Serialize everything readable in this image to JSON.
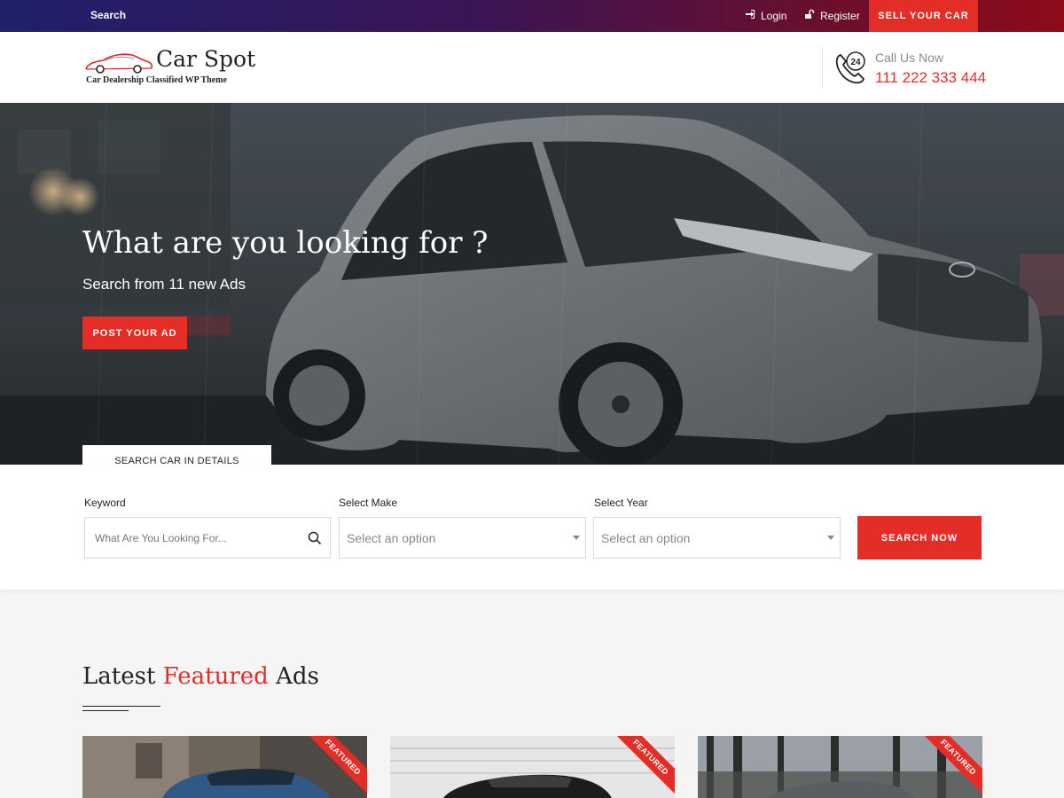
{
  "topbar": {
    "search_label": "Search",
    "login_label": "Login",
    "register_label": "Register",
    "sell_label": "SELL YOUR CAR"
  },
  "header": {
    "logo_name": "Car Spot",
    "logo_tagline": "Car Dealership Classified WP Theme",
    "call_label": "Call Us Now",
    "call_number": "111 222 333 444",
    "call_icon_text": "24"
  },
  "hero": {
    "title": "What are you looking for ?",
    "subtitle": "Search from 11 new Ads",
    "post_button": "POST YOUR AD",
    "search_tab": "SEARCH CAR IN DETAILS"
  },
  "search": {
    "keyword_label": "Keyword",
    "keyword_placeholder": "What Are You Looking For...",
    "make_label": "Select Make",
    "make_value": "Select an option",
    "year_label": "Select Year",
    "year_value": "Select an option",
    "button": "SEARCH NOW"
  },
  "featured": {
    "title_part1": "Latest ",
    "title_highlight": "Featured",
    "title_part2": " Ads",
    "cards": [
      {
        "ribbon": "FEATURED"
      },
      {
        "ribbon": "FEATURED"
      },
      {
        "ribbon": "FEATURED"
      }
    ]
  },
  "colors": {
    "accent": "#e52d27",
    "topbar_start": "#20206b",
    "topbar_end": "#8c0c1c",
    "text_dark": "#232323"
  },
  "icons": {
    "login": "sign-in-icon",
    "register": "unlock-icon",
    "call": "phone-24-icon",
    "keyword": "search-icon"
  }
}
